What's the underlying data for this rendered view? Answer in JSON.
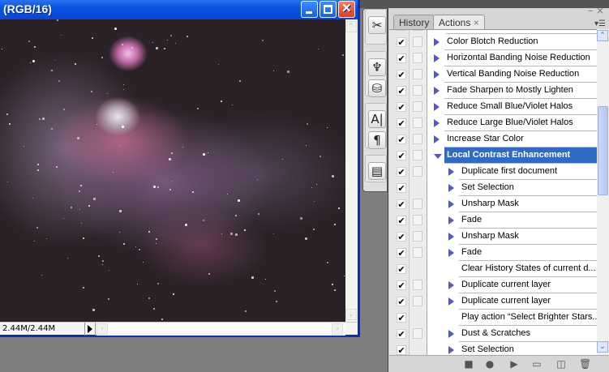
{
  "document": {
    "title": "(RGB/16)",
    "status": "2.44M/2.44M",
    "buttons": {
      "minimize": "_",
      "maximize": "□",
      "close": "✕"
    }
  },
  "panel": {
    "tabs": [
      {
        "label": "History",
        "active": false
      },
      {
        "label": "Actions",
        "active": true,
        "close": "×"
      }
    ],
    "actions": [
      {
        "label": "Color Blotch Reduction",
        "checked": true,
        "dialog": true,
        "level": 1,
        "expand": "collapsed"
      },
      {
        "label": "Horizontal Banding Noise Reduction",
        "checked": true,
        "dialog": true,
        "level": 1,
        "expand": "collapsed"
      },
      {
        "label": "Vertical Banding Noise Reduction",
        "checked": true,
        "dialog": true,
        "level": 1,
        "expand": "collapsed"
      },
      {
        "label": "Fade Sharpen to Mostly Lighten",
        "checked": true,
        "dialog": true,
        "level": 1,
        "expand": "collapsed"
      },
      {
        "label": "Reduce Small Blue/Violet Halos",
        "checked": true,
        "dialog": true,
        "level": 1,
        "expand": "collapsed"
      },
      {
        "label": "Reduce Large Blue/Violet Halos",
        "checked": true,
        "dialog": true,
        "level": 1,
        "expand": "collapsed"
      },
      {
        "label": "Increase Star Color",
        "checked": true,
        "dialog": true,
        "level": 1,
        "expand": "collapsed"
      },
      {
        "label": "Local Contrast Enhancement",
        "checked": true,
        "dialog": true,
        "level": 1,
        "expand": "open",
        "selected": true
      },
      {
        "label": "Duplicate first document",
        "checked": true,
        "dialog": true,
        "level": 2,
        "expand": "collapsed"
      },
      {
        "label": "Set Selection",
        "checked": true,
        "dialog": false,
        "level": 2,
        "expand": "collapsed"
      },
      {
        "label": "Unsharp Mask",
        "checked": true,
        "dialog": true,
        "level": 2,
        "expand": "collapsed"
      },
      {
        "label": "Fade",
        "checked": true,
        "dialog": true,
        "level": 2,
        "expand": "collapsed"
      },
      {
        "label": "Unsharp Mask",
        "checked": true,
        "dialog": true,
        "level": 2,
        "expand": "collapsed"
      },
      {
        "label": "Fade",
        "checked": true,
        "dialog": true,
        "level": 2,
        "expand": "collapsed"
      },
      {
        "label": "Clear History States of current d...",
        "checked": true,
        "dialog": false,
        "level": 2,
        "expand": "none"
      },
      {
        "label": "Duplicate current layer",
        "checked": true,
        "dialog": true,
        "level": 2,
        "expand": "collapsed"
      },
      {
        "label": "Duplicate current layer",
        "checked": true,
        "dialog": true,
        "level": 2,
        "expand": "collapsed"
      },
      {
        "label": "Play action “Select Brighter Stars...",
        "checked": true,
        "dialog": false,
        "level": 2,
        "expand": "none"
      },
      {
        "label": "Dust & Scratches",
        "checked": true,
        "dialog": true,
        "level": 2,
        "expand": "collapsed"
      },
      {
        "label": "Set Selection",
        "checked": true,
        "dialog": false,
        "level": 2,
        "expand": "collapsed"
      }
    ],
    "bottom_buttons": [
      {
        "name": "stop",
        "glyph": "■"
      },
      {
        "name": "record",
        "glyph": "●"
      },
      {
        "name": "play",
        "glyph": "▶"
      },
      {
        "name": "new-set",
        "glyph": "▭"
      },
      {
        "name": "new-action",
        "glyph": "◫"
      },
      {
        "name": "delete",
        "glyph": "🗑"
      }
    ]
  },
  "tools": [
    {
      "name": "tools-preset",
      "glyph": "✂"
    },
    {
      "name": "brushes",
      "glyph": "♆"
    },
    {
      "name": "clone-source",
      "glyph": "⛁"
    },
    {
      "name": "character",
      "glyph": "A|"
    },
    {
      "name": "paragraph",
      "glyph": "¶"
    },
    {
      "name": "layer-comps",
      "glyph": "▤"
    }
  ],
  "colors": {
    "selection": "#316ac5",
    "titlebar": "#0a52e0",
    "triangle": "#5555cc"
  }
}
